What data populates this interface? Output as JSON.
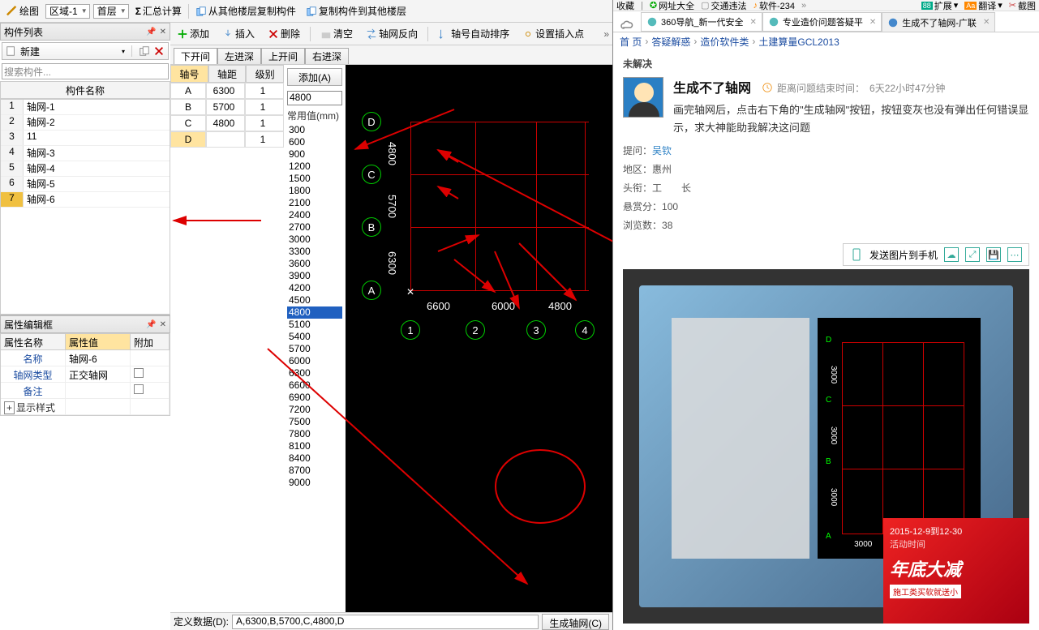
{
  "leftApp": {
    "toolbar": {
      "draw": "绘图",
      "region": "区域-1",
      "floor": "首层",
      "sumCalc": "汇总计算",
      "copyFromFloor": "从其他楼层复制构件",
      "copyToFloor": "复制构件到其他楼层"
    },
    "panel": {
      "title": "构件列表",
      "newBtn": "新建",
      "searchPh": "搜索构件...",
      "colName": "构件名称",
      "rows": [
        {
          "n": "1",
          "name": "轴网-1"
        },
        {
          "n": "2",
          "name": "轴网-2"
        },
        {
          "n": "3",
          "name": "11"
        },
        {
          "n": "4",
          "name": "轴网-3"
        },
        {
          "n": "5",
          "name": "轴网-4"
        },
        {
          "n": "6",
          "name": "轴网-5"
        },
        {
          "n": "7",
          "name": "轴网-6"
        }
      ]
    },
    "propPanel": {
      "title": "属性编辑框",
      "hdr": {
        "c1": "属性名称",
        "c2": "属性值",
        "c3": "附加"
      },
      "rows": [
        {
          "c1": "名称",
          "c2": "轴网-6",
          "chk": false
        },
        {
          "c1": "轴网类型",
          "c2": "正交轴网",
          "chk": true
        },
        {
          "c1": "备注",
          "c2": "",
          "chk": true
        }
      ],
      "expand": "显示样式"
    },
    "centerToolbar": {
      "add": "添加",
      "insert": "插入",
      "delete": "删除",
      "clear": "清空",
      "reverse": "轴网反向",
      "autoSort": "轴号自动排序",
      "setInsert": "设置插入点"
    },
    "tabs": [
      "下开间",
      "左进深",
      "上开间",
      "右进深"
    ],
    "axisTable": {
      "hdr": [
        "轴号",
        "轴距",
        "级别"
      ],
      "rows": [
        {
          "a": "A",
          "d": "6300",
          "l": "1"
        },
        {
          "a": "B",
          "d": "5700",
          "l": "1"
        },
        {
          "a": "C",
          "d": "4800",
          "l": "1"
        },
        {
          "a": "D",
          "d": "",
          "l": "1"
        }
      ]
    },
    "valPanel": {
      "addBtn": "添加(A)",
      "curVal": "4800",
      "commonLbl": "常用值(mm)",
      "vals": [
        "300",
        "600",
        "900",
        "1200",
        "1500",
        "1800",
        "2100",
        "2400",
        "2700",
        "3000",
        "3300",
        "3600",
        "3900",
        "4200",
        "4500",
        "4800",
        "5100",
        "5400",
        "5700",
        "6000",
        "6300",
        "6600",
        "6900",
        "7200",
        "7500",
        "7800",
        "8100",
        "8400",
        "8700",
        "9000"
      ],
      "sel": "4800"
    },
    "canvas": {
      "vAxis": [
        "A",
        "B",
        "C",
        "D"
      ],
      "hAxis": [
        "1",
        "2",
        "3",
        "4"
      ],
      "vDims": [
        "6300",
        "5700",
        "4800"
      ],
      "hDims": [
        "6600",
        "6000",
        "4800"
      ]
    },
    "bottom": {
      "label": "定义数据(D):",
      "value": "A,6300,B,5700,C,4800,D",
      "genBtn": "生成轴网(C)"
    }
  },
  "browser": {
    "topbar": {
      "fav": "收藏",
      "netAll": "网址大全",
      "traffic": "交通违法",
      "soft": "软件-234",
      "ext": "扩展",
      "trans": "翻译",
      "shot": "截图"
    },
    "tabs": [
      {
        "icon": "#5bb",
        "title": "360导航_新一代安全",
        "active": false
      },
      {
        "icon": "#5bb",
        "title": "专业造价问题答疑平",
        "active": false
      },
      {
        "icon": "#48c",
        "title": "生成不了轴网-广联",
        "active": true
      }
    ],
    "crumb": [
      "首 页",
      "答疑解惑",
      "造价软件类",
      "土建算量GCL2013"
    ],
    "status": "未解决",
    "q": {
      "title": "生成不了轴网",
      "timeLabel": "距离问题结束时间：",
      "timeVal": "6天22小时47分钟",
      "body": "画完轴网后，点击右下角的\"生成轴网\"按钮，按钮变灰也没有弹出任何错误显示，求大神能助我解决这问题"
    },
    "meta": {
      "askLbl": "提问：",
      "askVal": "吴钦",
      "regLbl": "地区：",
      "regVal": "惠州",
      "titLbl": "头衔：",
      "titVal": "工　　长",
      "bonLbl": "悬赏分：",
      "bonVal": "100",
      "vwLbl": "浏览数：",
      "vwVal": "38"
    },
    "imgToolbar": "发送图片到手机",
    "promo": {
      "dates": "2015-12-9到12-30",
      "sub": "活动时间",
      "big": "年底大减",
      "rib": "施工类买软就送小"
    }
  }
}
